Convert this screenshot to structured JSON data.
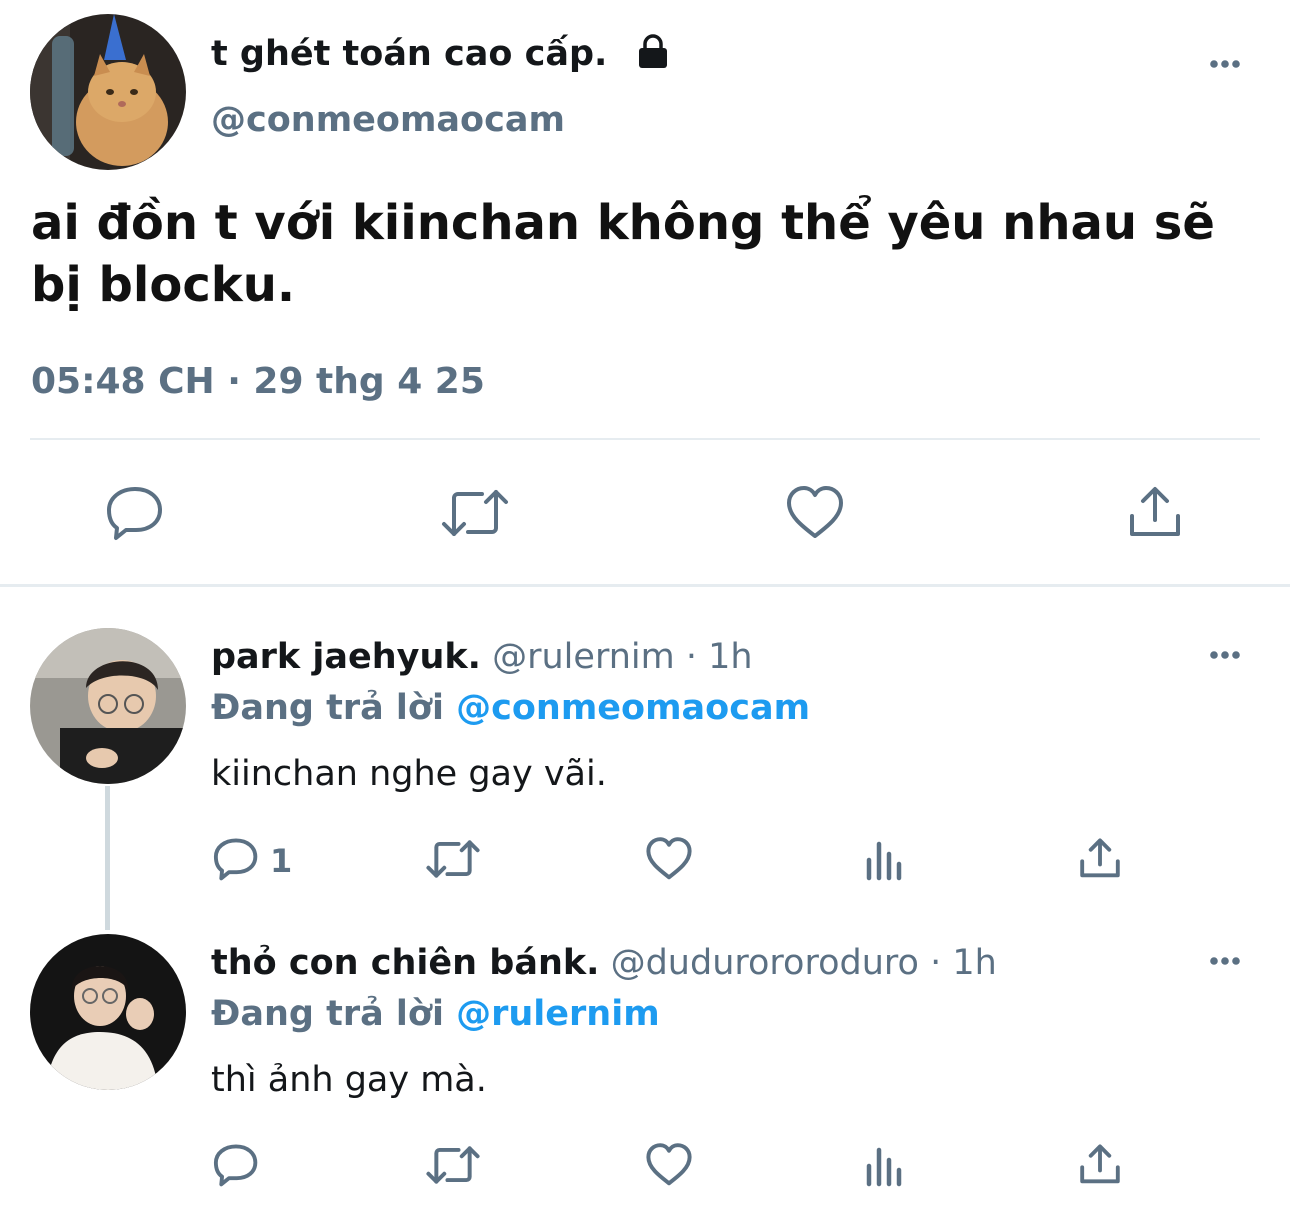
{
  "tweet": {
    "display_name": "t ghét toán cao cấp.",
    "handle": "@conmeomaocam",
    "text": "ai đồn t với kiinchan không thể yêu nhau sẽ bị blocku.",
    "timestamp": "05:48 CH · 29 thg 4 25",
    "protected": true
  },
  "replies": [
    {
      "display_name": "park jaehyuk.",
      "handle": "@rulernim",
      "time": "· 1h",
      "replying_label": "Đang trả lời",
      "replying_to": "@conmeomaocam",
      "text": "kiinchan nghe gay vãi.",
      "reply_count": "1"
    },
    {
      "display_name": "thỏ con chiên bánk.",
      "handle": "@dudurororoduro",
      "time": "· 1h",
      "replying_label": "Đang trả lời",
      "replying_to": "@rulernim",
      "text": "thì ảnh gay mà.",
      "reply_count": ""
    }
  ],
  "colors": {
    "accent": "#1d9bf0",
    "secondary_text": "#5b7083",
    "icon": "#5b7083",
    "divider": "#e6ecf0"
  },
  "icons": [
    "lock-icon",
    "more-icon",
    "reply-icon",
    "retweet-icon",
    "like-icon",
    "share-icon",
    "analytics-icon"
  ]
}
